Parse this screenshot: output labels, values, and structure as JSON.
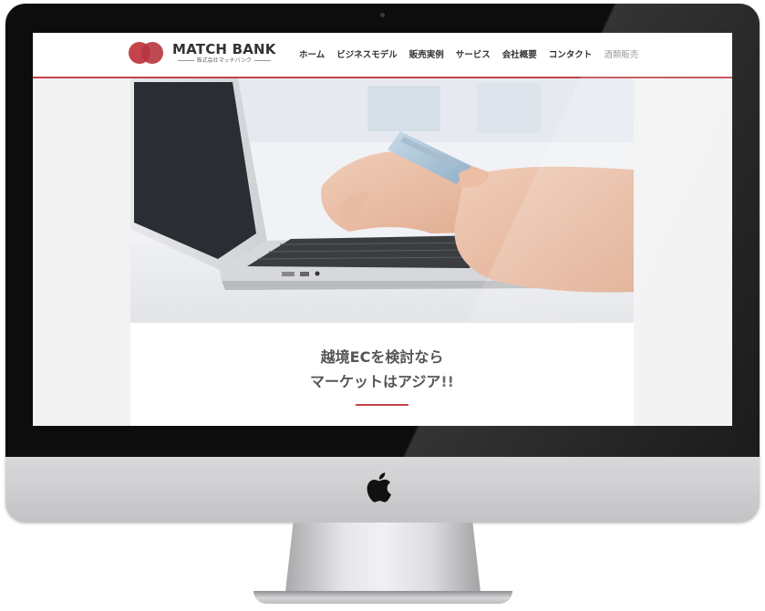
{
  "site": {
    "brand_name": "MATCH BANK",
    "brand_sub": "株式会社マッチバンク",
    "accent": "#c1444c"
  },
  "nav": {
    "items": [
      {
        "label": "ホーム"
      },
      {
        "label": "ビジネスモデル"
      },
      {
        "label": "販売実例"
      },
      {
        "label": "サービス"
      },
      {
        "label": "会社概要"
      },
      {
        "label": "コンタクト"
      },
      {
        "label": "酒類販売"
      }
    ]
  },
  "hero": {
    "headline_line1": "越境ECを検討なら",
    "headline_line2": "マーケットはアジア!!"
  },
  "icons": {
    "hardware_logo": "apple-icon"
  }
}
